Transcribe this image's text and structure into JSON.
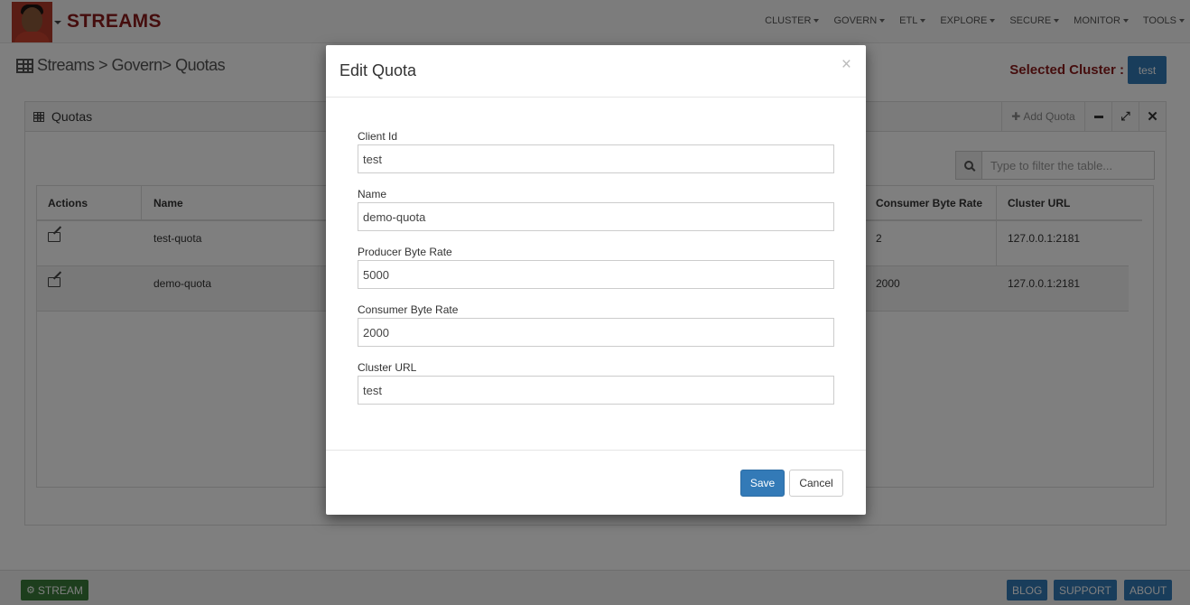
{
  "app": {
    "brand": "STREAMS"
  },
  "nav": {
    "items": [
      "CLUSTER",
      "GOVERN",
      "ETL",
      "EXPLORE",
      "SECURE",
      "MONITOR",
      "TOOLS"
    ]
  },
  "breadcrumb": {
    "text": "Streams > Govern> Quotas"
  },
  "selected_cluster": {
    "label": "Selected Cluster :",
    "value": "test"
  },
  "panel": {
    "title": "Quotas",
    "add_label": "Add Quota",
    "search_placeholder": "Type to filter the table..."
  },
  "table": {
    "columns": [
      "Actions",
      "Name",
      "Consumer Byte Rate",
      "Cluster URL"
    ],
    "rows": [
      {
        "name": "test-quota",
        "consumer_byte_rate": "2",
        "cluster_url": "127.0.0.1:2181"
      },
      {
        "name": "demo-quota",
        "consumer_byte_rate": "2000",
        "cluster_url": "127.0.0.1:2181"
      }
    ]
  },
  "modal": {
    "title": "Edit Quota",
    "close": "×",
    "fields": [
      {
        "label": "Client Id",
        "value": "test"
      },
      {
        "label": "Name",
        "value": "demo-quota"
      },
      {
        "label": "Producer Byte Rate",
        "value": "5000"
      },
      {
        "label": "Consumer Byte Rate",
        "value": "2000"
      },
      {
        "label": "Cluster URL",
        "value": "test"
      }
    ],
    "save_label": "Save",
    "cancel_label": "Cancel"
  },
  "footer": {
    "stream_label": "STREAM",
    "blog_label": "BLOG",
    "support_label": "SUPPORT",
    "about_label": "ABOUT"
  },
  "colors": {
    "brand": "#8b1b1b",
    "primary": "#337ab7",
    "stream": "#3b7d3b"
  }
}
